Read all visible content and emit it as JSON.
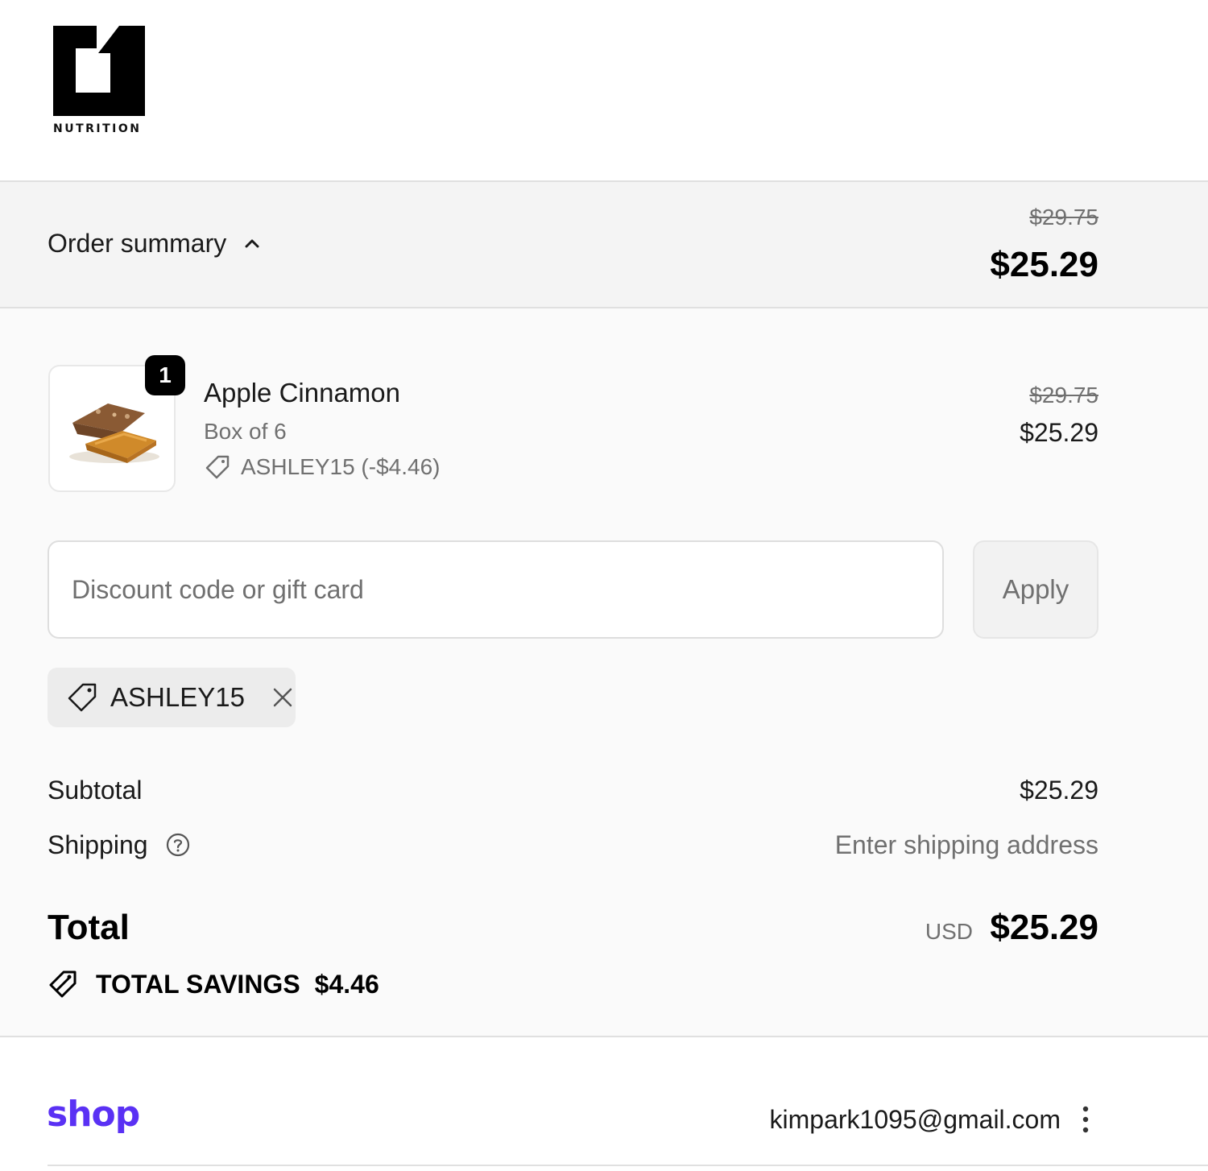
{
  "brand": {
    "logo_text": "NUTRITION"
  },
  "summary": {
    "toggle_label": "Order summary",
    "original_price": "$29.75",
    "price": "$25.29",
    "icon": "chevron-up-icon"
  },
  "product": {
    "name": "Apple Cinnamon",
    "variant": "Box of 6",
    "quantity": "1",
    "discount": "ASHLEY15 (-$4.46)",
    "original_price": "$29.75",
    "price": "$25.29",
    "image": "protein-bar-image"
  },
  "discount_form": {
    "placeholder": "Discount code or gift card",
    "value": "",
    "apply_label": "Apply"
  },
  "applied_code": {
    "code": "ASHLEY15"
  },
  "totals": {
    "subtotal_label": "Subtotal",
    "subtotal_value": "$25.29",
    "shipping_label": "Shipping",
    "shipping_value": "Enter shipping address",
    "total_label": "Total",
    "currency": "USD",
    "total_value": "$25.29",
    "savings_label": "TOTAL SAVINGS",
    "savings_value": "$4.46"
  },
  "footer": {
    "shop_label": "shop",
    "email": "kimpark1095@gmail.com"
  },
  "colors": {
    "shop_purple": "#5a31f4",
    "summary_bg": "#f4f4f4",
    "main_bg": "#fafafa",
    "muted_text": "#707070"
  }
}
